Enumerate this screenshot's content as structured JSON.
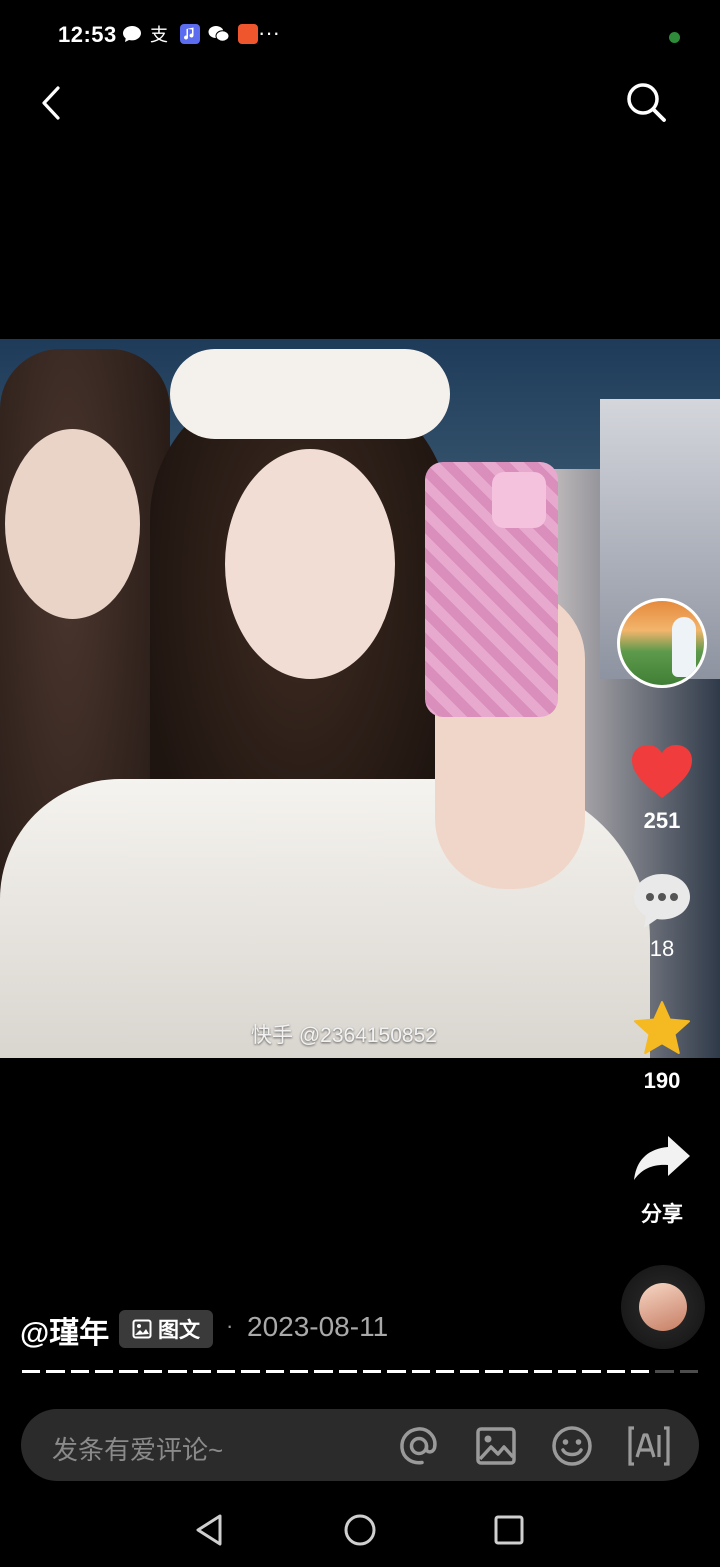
{
  "status_bar": {
    "time": "12:53",
    "icons": [
      "chat-bubble-icon",
      "alipay-icon",
      "music-icon",
      "wechat-icon",
      "app-icon"
    ],
    "more": "···"
  },
  "photo": {
    "watermark": "快手 @2364150852"
  },
  "actions": {
    "likes": "251",
    "comments": "18",
    "favorites": "190",
    "share_label": "分享"
  },
  "post": {
    "author": "@瑾年",
    "type_tag": "图文",
    "separator": "·",
    "date": "2023-08-11",
    "progress_segments_total": 28,
    "progress_segments_viewed": 26
  },
  "comment": {
    "placeholder": "发条有爱评论~"
  },
  "colors": {
    "like": "#f03c3c",
    "star": "#f5b922",
    "comment_bar": "#2b2b2b"
  }
}
